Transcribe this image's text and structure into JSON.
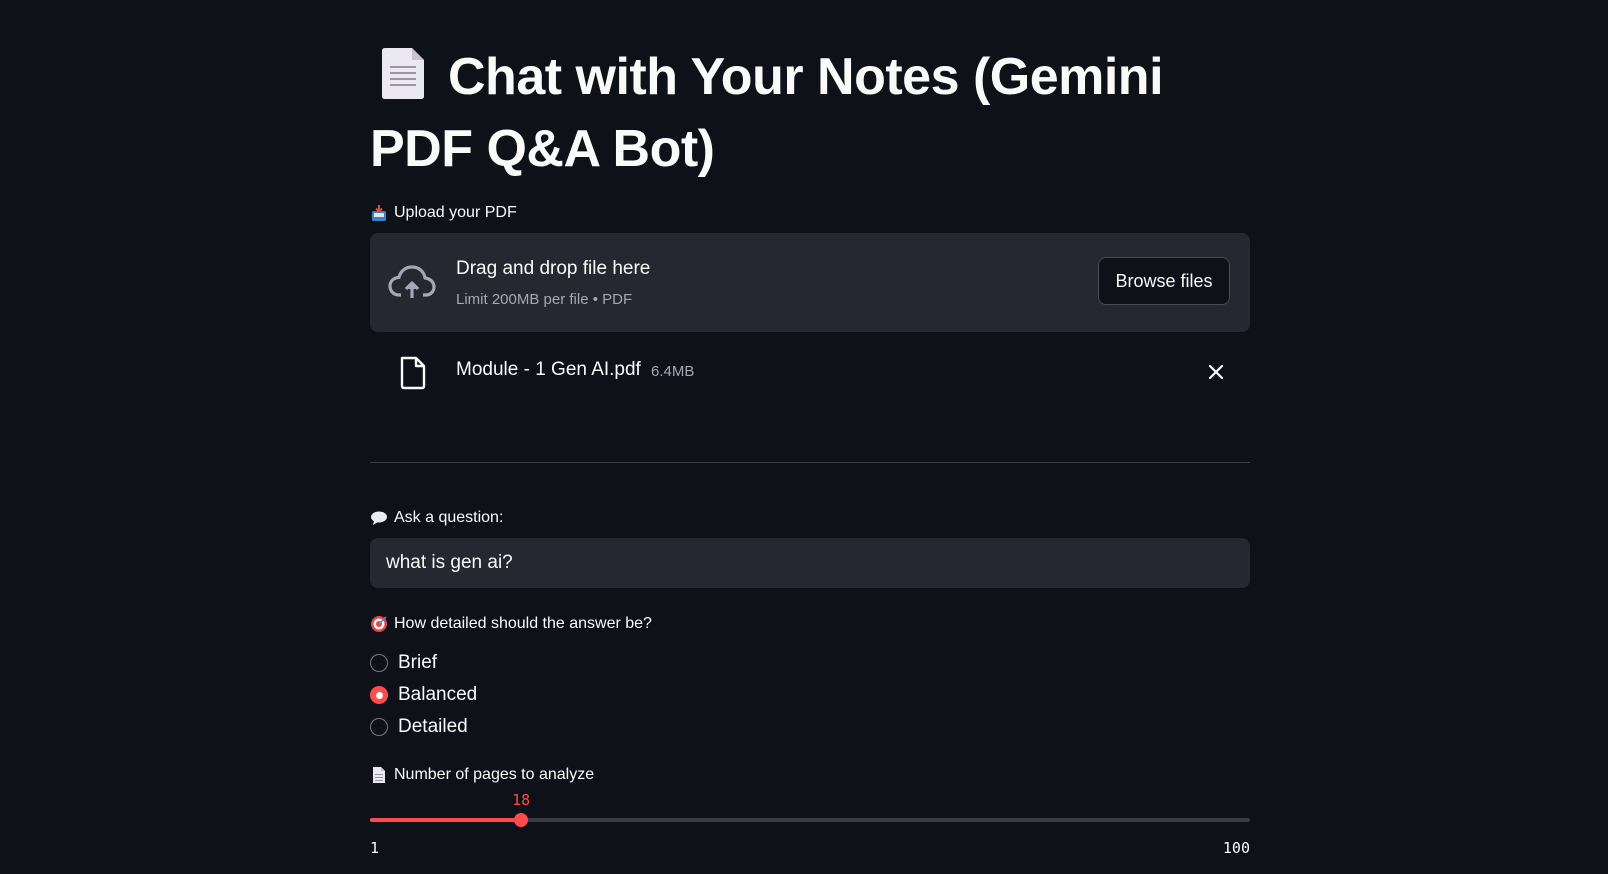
{
  "page": {
    "title": "Chat with Your Notes (Gemini PDF Q&A Bot)",
    "title_icon": "page-facing-up-icon"
  },
  "upload": {
    "label": "Upload your PDF",
    "label_icon": "inbox-tray-icon",
    "drop_title": "Drag and drop file here",
    "drop_subtitle": "Limit 200MB per file • PDF",
    "browse_label": "Browse files",
    "file": {
      "name": "Module - 1 Gen AI.pdf",
      "size": "6.4MB"
    }
  },
  "question": {
    "label": "Ask a question:",
    "label_icon": "speech-balloon-icon",
    "value": "what is gen ai?"
  },
  "detail": {
    "label": "How detailed should the answer be?",
    "label_icon": "direct-hit-icon",
    "options": [
      {
        "label": "Brief",
        "selected": false
      },
      {
        "label": "Balanced",
        "selected": true
      },
      {
        "label": "Detailed",
        "selected": false
      }
    ]
  },
  "pages": {
    "label": "Number of pages to analyze",
    "label_icon": "page-facing-up-icon",
    "value": "18",
    "min": "1",
    "max": "100"
  },
  "colors": {
    "background": "#0e1117",
    "surface": "#262730",
    "accent": "#ff4b4b",
    "text": "#fafafa",
    "muted_text": "#a3a8b8"
  }
}
